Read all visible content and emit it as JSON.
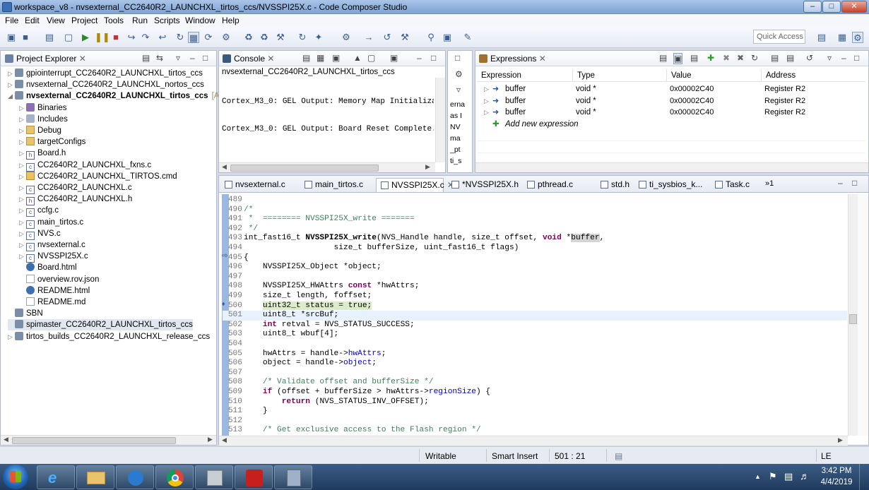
{
  "window": {
    "title": "workspace_v8 - nvsexternal_CC2640R2_LAUNCHXL_tirtos_ccs/NVSSPI25X.c - Code Composer Studio"
  },
  "menu": [
    "File",
    "Edit",
    "View",
    "Project",
    "Tools",
    "Run",
    "Scripts",
    "Window",
    "Help"
  ],
  "toolbar": {
    "quick_access": "Quick Access"
  },
  "project_explorer": {
    "title": "Project Explorer",
    "items": [
      {
        "label": "gpiointerrupt_CC2640R2_LAUNCHXL_tirtos_ccs",
        "icon": "project-icon",
        "level": 0,
        "arrow": "collapsed"
      },
      {
        "label": "nvsexternal_CC2640R2_LAUNCHXL_nortos_ccs",
        "icon": "project-icon",
        "level": 0,
        "arrow": "collapsed"
      },
      {
        "label": "nvsexternal_CC2640R2_LAUNCHXL_tirtos_ccs",
        "suffix": "[Activ",
        "icon": "project-icon",
        "level": 0,
        "arrow": "expanded",
        "bold": true
      },
      {
        "label": "Binaries",
        "icon": "binaries-icon",
        "level": 1,
        "arrow": "collapsed"
      },
      {
        "label": "Includes",
        "icon": "includes-icon",
        "level": 1,
        "arrow": "collapsed"
      },
      {
        "label": "Debug",
        "icon": "folder-icon",
        "level": 1,
        "arrow": "collapsed"
      },
      {
        "label": "targetConfigs",
        "icon": "folder-icon",
        "level": 1,
        "arrow": "collapsed"
      },
      {
        "label": "Board.h",
        "icon": "h-file-icon",
        "level": 1,
        "arrow": "collapsed"
      },
      {
        "label": "CC2640R2_LAUNCHXL_fxns.c",
        "icon": "c-file-icon",
        "level": 1,
        "arrow": "collapsed"
      },
      {
        "label": "CC2640R2_LAUNCHXL_TIRTOS.cmd",
        "icon": "cmd-file-icon",
        "level": 1,
        "arrow": "collapsed"
      },
      {
        "label": "CC2640R2_LAUNCHXL.c",
        "icon": "c-file-icon",
        "level": 1,
        "arrow": "collapsed"
      },
      {
        "label": "CC2640R2_LAUNCHXL.h",
        "icon": "h-file-icon",
        "level": 1,
        "arrow": "collapsed"
      },
      {
        "label": "ccfg.c",
        "icon": "c-file-icon",
        "level": 1,
        "arrow": "collapsed"
      },
      {
        "label": "main_tirtos.c",
        "icon": "c-file-icon",
        "level": 1,
        "arrow": "collapsed"
      },
      {
        "label": "NVS.c",
        "icon": "c-file-icon",
        "level": 1,
        "arrow": "collapsed"
      },
      {
        "label": "nvsexternal.c",
        "icon": "c-file-icon",
        "level": 1,
        "arrow": "collapsed"
      },
      {
        "label": "NVSSPI25X.c",
        "icon": "c-file-icon",
        "level": 1,
        "arrow": "collapsed"
      },
      {
        "label": "Board.html",
        "icon": "html-file-icon",
        "level": 1,
        "arrow": "none"
      },
      {
        "label": "overview.rov.json",
        "icon": "file-icon",
        "level": 1,
        "arrow": "none"
      },
      {
        "label": "README.html",
        "icon": "html-file-icon",
        "level": 1,
        "arrow": "none"
      },
      {
        "label": "README.md",
        "icon": "file-icon",
        "level": 1,
        "arrow": "none"
      },
      {
        "label": "SBN",
        "icon": "project-icon",
        "level": 0,
        "arrow": "none"
      },
      {
        "label": "spimaster_CC2640R2_LAUNCHXL_tirtos_ccs",
        "icon": "project-icon",
        "level": 0,
        "arrow": "none",
        "selected": true
      },
      {
        "label": "tirtos_builds_CC2640R2_LAUNCHXL_release_ccs",
        "icon": "project-icon",
        "level": 0,
        "arrow": "collapsed"
      }
    ]
  },
  "console": {
    "title": "Console",
    "project": "nvsexternal_CC2640R2_LAUNCHXL_tirtos_ccs",
    "lines": [
      "Cortex_M3_0: GEL Output: Memory Map Initializat",
      "Cortex_M3_0: GEL Output: Board Reset Complete."
    ],
    "side_fragments": [
      "erna",
      "as I",
      "NV",
      "ma",
      "_pt",
      "ti_s"
    ]
  },
  "expressions": {
    "title": "Expressions",
    "columns": [
      "Expression",
      "Type",
      "Value",
      "Address"
    ],
    "rows": [
      {
        "expression": "buffer",
        "type": "void *",
        "value": "0x00002C40",
        "address": "Register R2"
      },
      {
        "expression": "buffer",
        "type": "void *",
        "value": "0x00002C40",
        "address": "Register R2"
      },
      {
        "expression": "buffer",
        "type": "void *",
        "value": "0x00002C40",
        "address": "Register R2"
      }
    ],
    "add_new": "Add new expression"
  },
  "editor": {
    "tabs": [
      {
        "label": "nvsexternal.c",
        "active": false
      },
      {
        "label": "main_tirtos.c",
        "active": false
      },
      {
        "label": "NVSSPI25X.c",
        "active": true
      },
      {
        "label": "*NVSSPI25X.h",
        "active": false
      },
      {
        "label": "pthread.c",
        "active": false
      },
      {
        "label": "std.h",
        "active": false
      },
      {
        "label": "ti_sysbios_k...",
        "active": false
      },
      {
        "label": "Task.c",
        "active": false
      }
    ],
    "overflow": "»1",
    "lines": [
      {
        "n": "489",
        "html": ""
      },
      {
        "n": "490",
        "html": "<span class=\"cm\">/*</span>"
      },
      {
        "n": "491",
        "html": "<span class=\"cm\"> *  ======== NVSSPI25X_write =======</span>"
      },
      {
        "n": "492",
        "html": "<span class=\"cm\"> */</span>"
      },
      {
        "n": "493",
        "html": "int_fast16_t <b>NVSSPI25X_write</b>(NVS_Handle handle, size_t offset, <span class=\"kw\">void</span> *<span style=\"background:#d4d4d4\">buffer</span>,"
      },
      {
        "n": "494",
        "html": "                   size_t bufferSize, uint_fast16_t flags)"
      },
      {
        "n": "495",
        "html": "{"
      },
      {
        "n": "496",
        "html": "    NVSSPI25X_Object *object;"
      },
      {
        "n": "497",
        "html": ""
      },
      {
        "n": "498",
        "html": "    NVSSPI25X_HWAttrs <span class=\"kw\">const</span> *hwAttrs;"
      },
      {
        "n": "499",
        "html": "    size_t length, foffset;"
      },
      {
        "n": "500",
        "html": "    <span class=\"hl\">uint32_t status = true;</span>"
      },
      {
        "n": "501",
        "html": "    uint8_t *srcBuf;"
      },
      {
        "n": "502",
        "html": "    <span class=\"kw\">int</span> retval = NVS_STATUS_SUCCESS;"
      },
      {
        "n": "503",
        "html": "    uint8_t wbuf[4];"
      },
      {
        "n": "504",
        "html": ""
      },
      {
        "n": "505",
        "html": "    hwAttrs = handle-><span class=\"fld\">hwAttrs</span>;"
      },
      {
        "n": "506",
        "html": "    object = handle-><span class=\"fld\">object</span>;"
      },
      {
        "n": "507",
        "html": ""
      },
      {
        "n": "508",
        "html": "    <span class=\"cm\">/* Validate offset and bufferSize */</span>"
      },
      {
        "n": "509",
        "html": "    <span class=\"kw\">if</span> (offset + bufferSize > hwAttrs-><span class=\"fld\">regionSize</span>) {"
      },
      {
        "n": "510",
        "html": "        <span class=\"kw\">return</span> (NVS_STATUS_INV_OFFSET);"
      },
      {
        "n": "511",
        "html": "    }"
      },
      {
        "n": "512",
        "html": ""
      },
      {
        "n": "513",
        "html": "    <span class=\"cm\">/* Get exclusive access to the Flash region */</span>"
      }
    ]
  },
  "status_bar": {
    "mode": "Writable",
    "insert": "Smart Insert",
    "position": "501 : 21",
    "line_ending": "LE"
  },
  "taskbar": {
    "time": "3:42 PM",
    "date": "4/4/2019"
  }
}
